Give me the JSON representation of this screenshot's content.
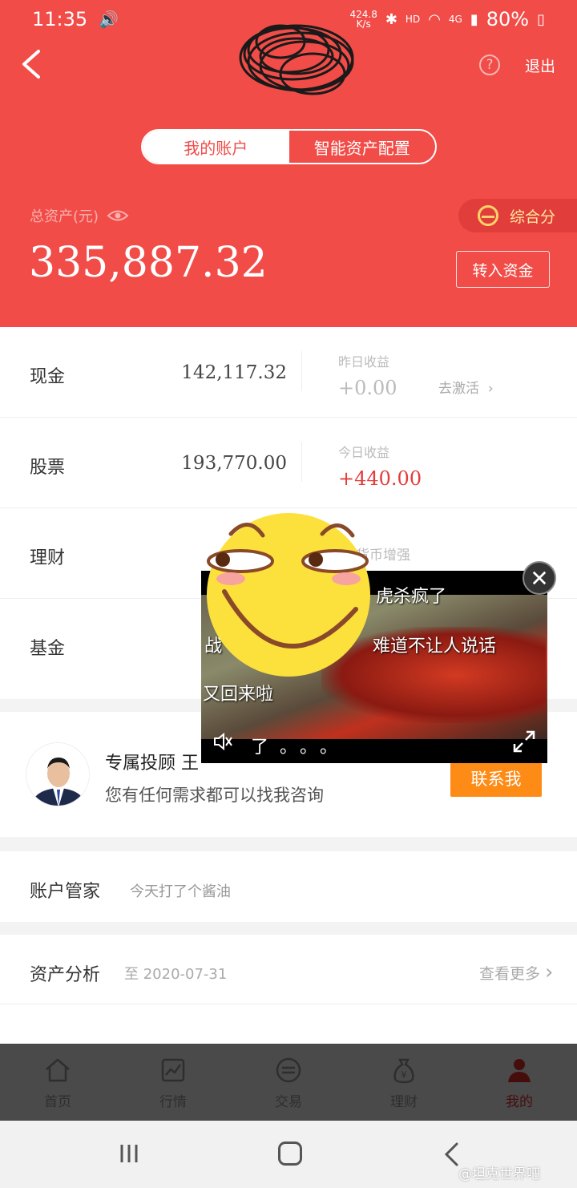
{
  "status_bar": {
    "time": "11:35",
    "speed": "424.8",
    "speed_unit": "K/s",
    "hd": "HD",
    "signal": "4G",
    "battery": "80%"
  },
  "header": {
    "logout_label": "退出",
    "help_label": "?",
    "tabs": [
      {
        "label": "我的账户",
        "active": true
      },
      {
        "label": "智能资产配置",
        "active": false
      }
    ],
    "total_assets_label": "总资产(元)",
    "total_assets_value": "335,887.32",
    "score_label": "综合分",
    "transfer_label": "转入资金"
  },
  "assets": [
    {
      "name": "现金",
      "amount": "142,117.32",
      "sub_label": "昨日收益",
      "sub_value": "+0.00",
      "action": "去激活"
    },
    {
      "name": "股票",
      "amount": "193,770.00",
      "sub_label": "今日收益",
      "sub_value": "+440.00"
    },
    {
      "name": "理财",
      "partial_text": "货币增强"
    },
    {
      "name": "基金"
    }
  ],
  "advisor": {
    "title": "专属投顾 王",
    "desc": "您有任何需求都可以找我咨询",
    "contact_label": "联系我"
  },
  "butler": {
    "title": "账户管家",
    "subtitle": "今天打了个酱油"
  },
  "analysis": {
    "title": "资产分析",
    "date": "至 2020-07-31",
    "more_label": "查看更多"
  },
  "bottom_nav": [
    {
      "label": "首页",
      "icon": "home-icon"
    },
    {
      "label": "行情",
      "icon": "chart-icon"
    },
    {
      "label": "交易",
      "icon": "exchange-icon"
    },
    {
      "label": "理财",
      "icon": "money-bag-icon"
    },
    {
      "label": "我的",
      "icon": "user-icon",
      "active": true
    }
  ],
  "video": {
    "captions": [
      "虎杀疯了",
      "战",
      "难道不让人说话",
      "又回来啦",
      "了。。。"
    ]
  },
  "watermark": "@坦克世界吧",
  "colors": {
    "brand_red": "#f14c48",
    "orange": "#fd8b16",
    "profit_red": "#e33d3a"
  }
}
